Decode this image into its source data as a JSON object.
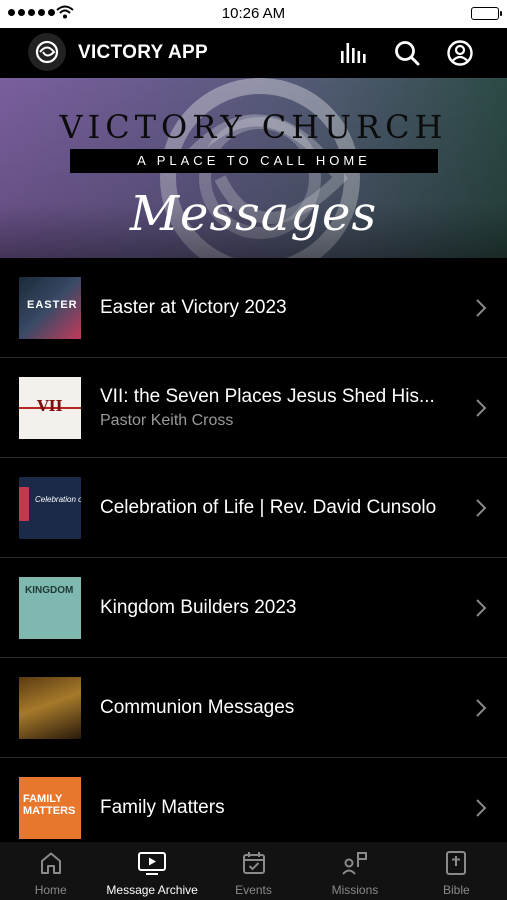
{
  "status_bar": {
    "time": "10:26 AM"
  },
  "header": {
    "title": "VICTORY APP"
  },
  "banner": {
    "title": "VICTORY CHURCH",
    "subtitle": "A PLACE TO CALL HOME",
    "script": "Messages"
  },
  "list": [
    {
      "title": "Easter at Victory 2023",
      "subtitle": "",
      "thumb_text": "EASTER"
    },
    {
      "title": "VII: the Seven Places Jesus Shed His...",
      "subtitle": "Pastor Keith Cross",
      "thumb_text": "VII"
    },
    {
      "title": "Celebration of Life | Rev. David Cunsolo",
      "subtitle": "",
      "thumb_text": "Celebration of"
    },
    {
      "title": "Kingdom Builders 2023",
      "subtitle": "",
      "thumb_text": "KINGDOM"
    },
    {
      "title": "Communion Messages",
      "subtitle": "",
      "thumb_text": ""
    },
    {
      "title": "Family Matters",
      "subtitle": "",
      "thumb_text": "FAMILY MATTERS"
    }
  ],
  "tabs": [
    {
      "label": "Home",
      "icon": "home-icon",
      "active": false
    },
    {
      "label": "Message Archive",
      "icon": "tv-play-icon",
      "active": true
    },
    {
      "label": "Events",
      "icon": "calendar-check-icon",
      "active": false
    },
    {
      "label": "Missions",
      "icon": "people-flag-icon",
      "active": false
    },
    {
      "label": "Bible",
      "icon": "bible-icon",
      "active": false
    }
  ],
  "colors": {
    "background": "#000000",
    "tab_inactive": "#8a8a8a",
    "subtitle": "#9a9a9a"
  }
}
